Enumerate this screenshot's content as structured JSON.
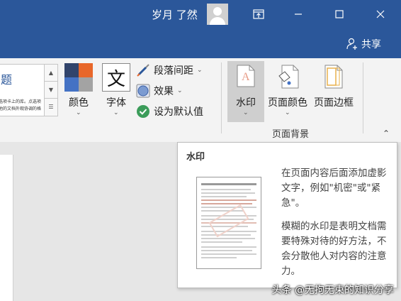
{
  "titlebar": {
    "user_name": "岁月 了然",
    "share_label": "共享"
  },
  "ribbon": {
    "gallery_title_fragment": "题",
    "gallery_text_line1": "选项卡上的库。点选项目",
    "gallery_text_line2": "他的文档外观协调的格式",
    "colors_label": "颜色",
    "fonts_label": "字体",
    "fonts_glyph": "文",
    "paragraph_spacing_label": "段落间距",
    "effects_label": "效果",
    "set_default_label": "设为默认值",
    "watermark_label": "水印",
    "page_color_label": "页面颜色",
    "page_borders_label": "页面边框",
    "group_label": "页面背景"
  },
  "tooltip": {
    "title": "水印",
    "desc1": "在页面内容后面添加虚影文字，例如\"机密\"或\"紧急\"。",
    "desc2": "模糊的水印是表明文档需要特殊对待的好方法，不会分散他人对内容的注意力。"
  },
  "credit": "头条 @无拘无束的知识分享",
  "colors": {
    "titlebar": "#2b579a",
    "ribbon": "#f3f3f3",
    "selected": "#cfcfcf"
  }
}
